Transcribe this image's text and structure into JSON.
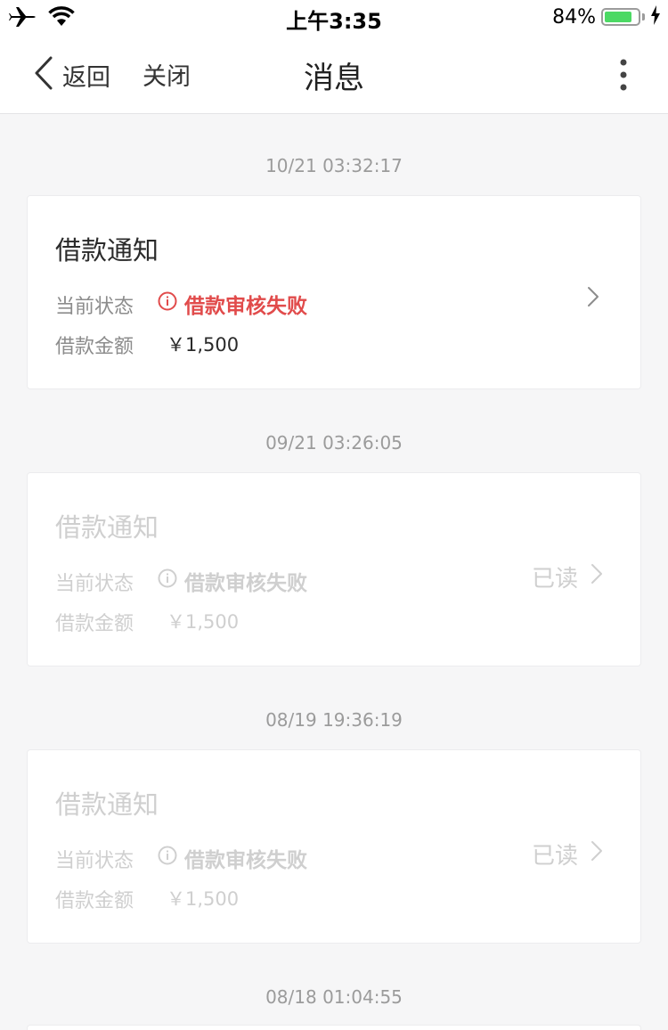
{
  "status_bar": {
    "time": "上午3:35",
    "battery_percent": "84%",
    "battery_level": 0.84,
    "icons": [
      "airplane-icon",
      "wifi-icon",
      "charging-bolt-icon"
    ]
  },
  "nav": {
    "back_label": "返回",
    "close_label": "关闭",
    "title": "消息",
    "more_icon": "more-vertical-icon"
  },
  "messages": [
    {
      "timestamp": "10/21 03:32:17",
      "title": "借款通知",
      "status_label": "当前状态",
      "status_value": "借款审核失败",
      "amount_label": "借款金额",
      "amount_value": "￥1,500",
      "read": false,
      "read_label": ""
    },
    {
      "timestamp": "09/21 03:26:05",
      "title": "借款通知",
      "status_label": "当前状态",
      "status_value": "借款审核失败",
      "amount_label": "借款金额",
      "amount_value": "￥1,500",
      "read": true,
      "read_label": "已读"
    },
    {
      "timestamp": "08/19 19:36:19",
      "title": "借款通知",
      "status_label": "当前状态",
      "status_value": "借款审核失败",
      "amount_label": "借款金额",
      "amount_value": "￥1,500",
      "read": true,
      "read_label": "已读"
    },
    {
      "timestamp": "08/18 01:04:55"
    }
  ],
  "colors": {
    "accent_error": "#e14b4b",
    "read_text": "#cfcfcf",
    "background": "#f6f6f7",
    "battery_fill": "#4cd964"
  }
}
